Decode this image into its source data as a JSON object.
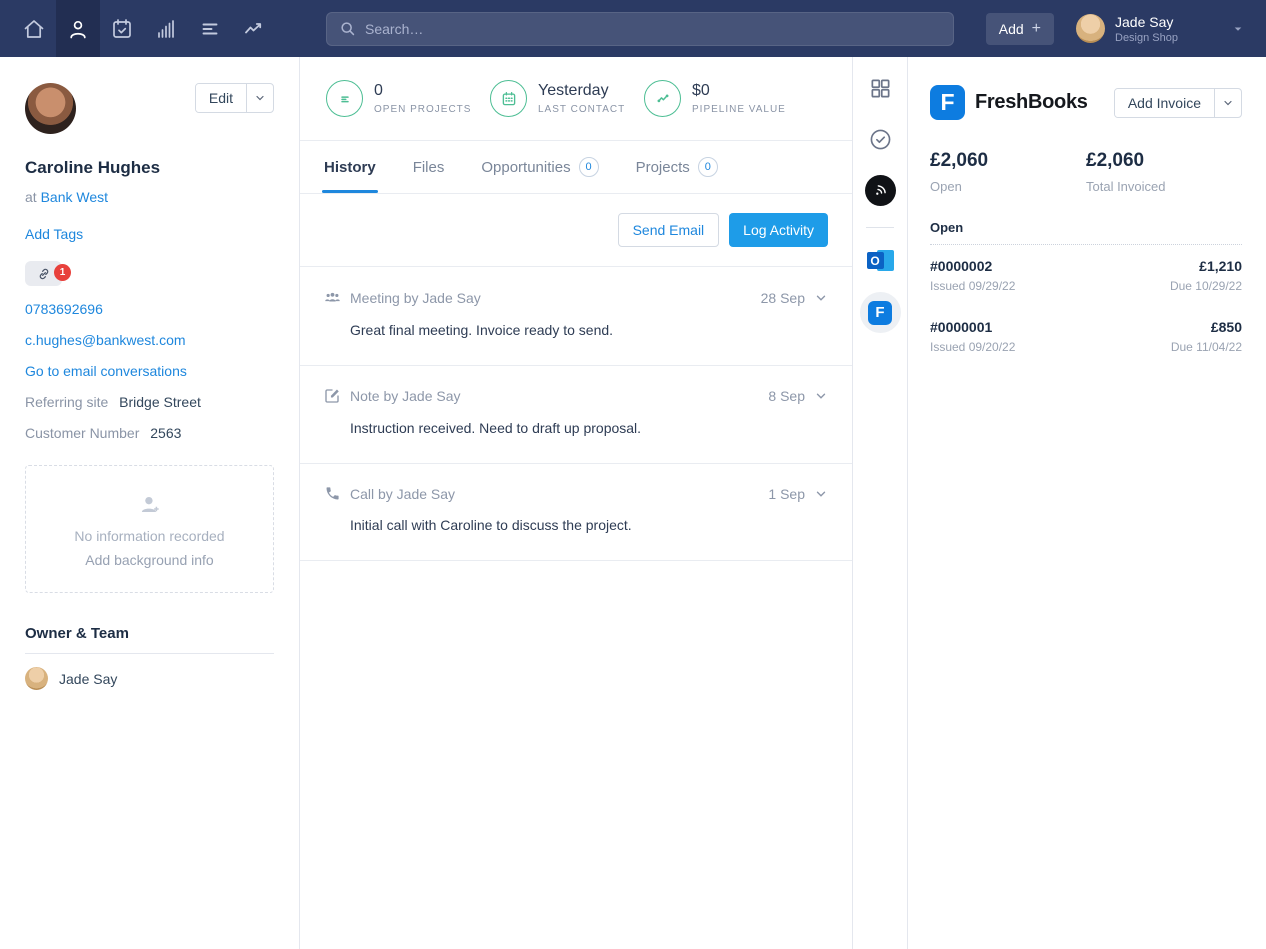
{
  "colors": {
    "navbar_bg": "#2b3a64",
    "navbar_active_bg": "#222e52",
    "link_blue": "#1e87dd",
    "primary_button_blue": "#1e9ce8",
    "stat_green": "#4dbe94",
    "badge_red": "#e8413c",
    "freshbooks_blue": "#0d7ce0"
  },
  "icons": {
    "nav": [
      "home-icon",
      "contacts-icon",
      "tasks-calendar-icon",
      "bar-chart-icon",
      "lists-icon",
      "trend-icon"
    ],
    "search": "magnifier",
    "rail": [
      "apps-grid-icon",
      "check-circle-icon",
      "broadcast-icon",
      "outlook-icon",
      "freshbooks-icon"
    ]
  },
  "navbar": {
    "search_placeholder": "Search…",
    "add_label": "Add",
    "add_plus": "+",
    "user": {
      "name": "Jade Say",
      "company": "Design Shop"
    }
  },
  "sidebar": {
    "edit_label": "Edit",
    "name": "Caroline Hughes",
    "company_prefix": "at",
    "company": "Bank West",
    "add_tags": "Add Tags",
    "attachment_count": "1",
    "phone": "0783692696",
    "email": "c.hughes@bankwest.com",
    "conversations_link": "Go to email conversations",
    "fields": [
      {
        "label": "Referring site",
        "value": "Bridge Street"
      },
      {
        "label": "Customer Number",
        "value": "2563"
      }
    ],
    "background": {
      "empty_text": "No information recorded",
      "add_link": "Add background info"
    },
    "owner_heading": "Owner & Team",
    "owner_name": "Jade Say"
  },
  "main": {
    "stats": [
      {
        "value": "0",
        "label": "OPEN PROJECTS"
      },
      {
        "value": "Yesterday",
        "label": "LAST CONTACT"
      },
      {
        "value": "$0",
        "label": "PIPELINE VALUE"
      }
    ],
    "tabs": [
      {
        "label": "History"
      },
      {
        "label": "Files"
      },
      {
        "label": "Opportunities",
        "badge": "0"
      },
      {
        "label": "Projects",
        "badge": "0"
      }
    ],
    "actions": {
      "send_email": "Send Email",
      "log_activity": "Log Activity"
    },
    "timeline": [
      {
        "title": "Meeting by Jade Say",
        "date": "28 Sep",
        "body": "Great final meeting. Invoice ready to send."
      },
      {
        "title": "Note by Jade Say",
        "date": "8 Sep",
        "body": "Instruction received. Need to draft up proposal."
      },
      {
        "title": "Call by Jade Say",
        "date": "1 Sep",
        "body": "Initial call with Caroline to discuss the project."
      }
    ]
  },
  "freshbooks": {
    "logo_letter": "F",
    "brand": "FreshBooks",
    "add_invoice_label": "Add Invoice",
    "outlook_letter": "O",
    "stats": [
      {
        "value": "£2,060",
        "label": "Open"
      },
      {
        "value": "£2,060",
        "label": "Total Invoiced"
      }
    ],
    "section_heading": "Open",
    "invoices": [
      {
        "number": "#0000002",
        "issued": "Issued 09/29/22",
        "amount": "£1,210",
        "due": "Due 10/29/22"
      },
      {
        "number": "#0000001",
        "issued": "Issued 09/20/22",
        "amount": "£850",
        "due": "Due 11/04/22"
      }
    ]
  }
}
